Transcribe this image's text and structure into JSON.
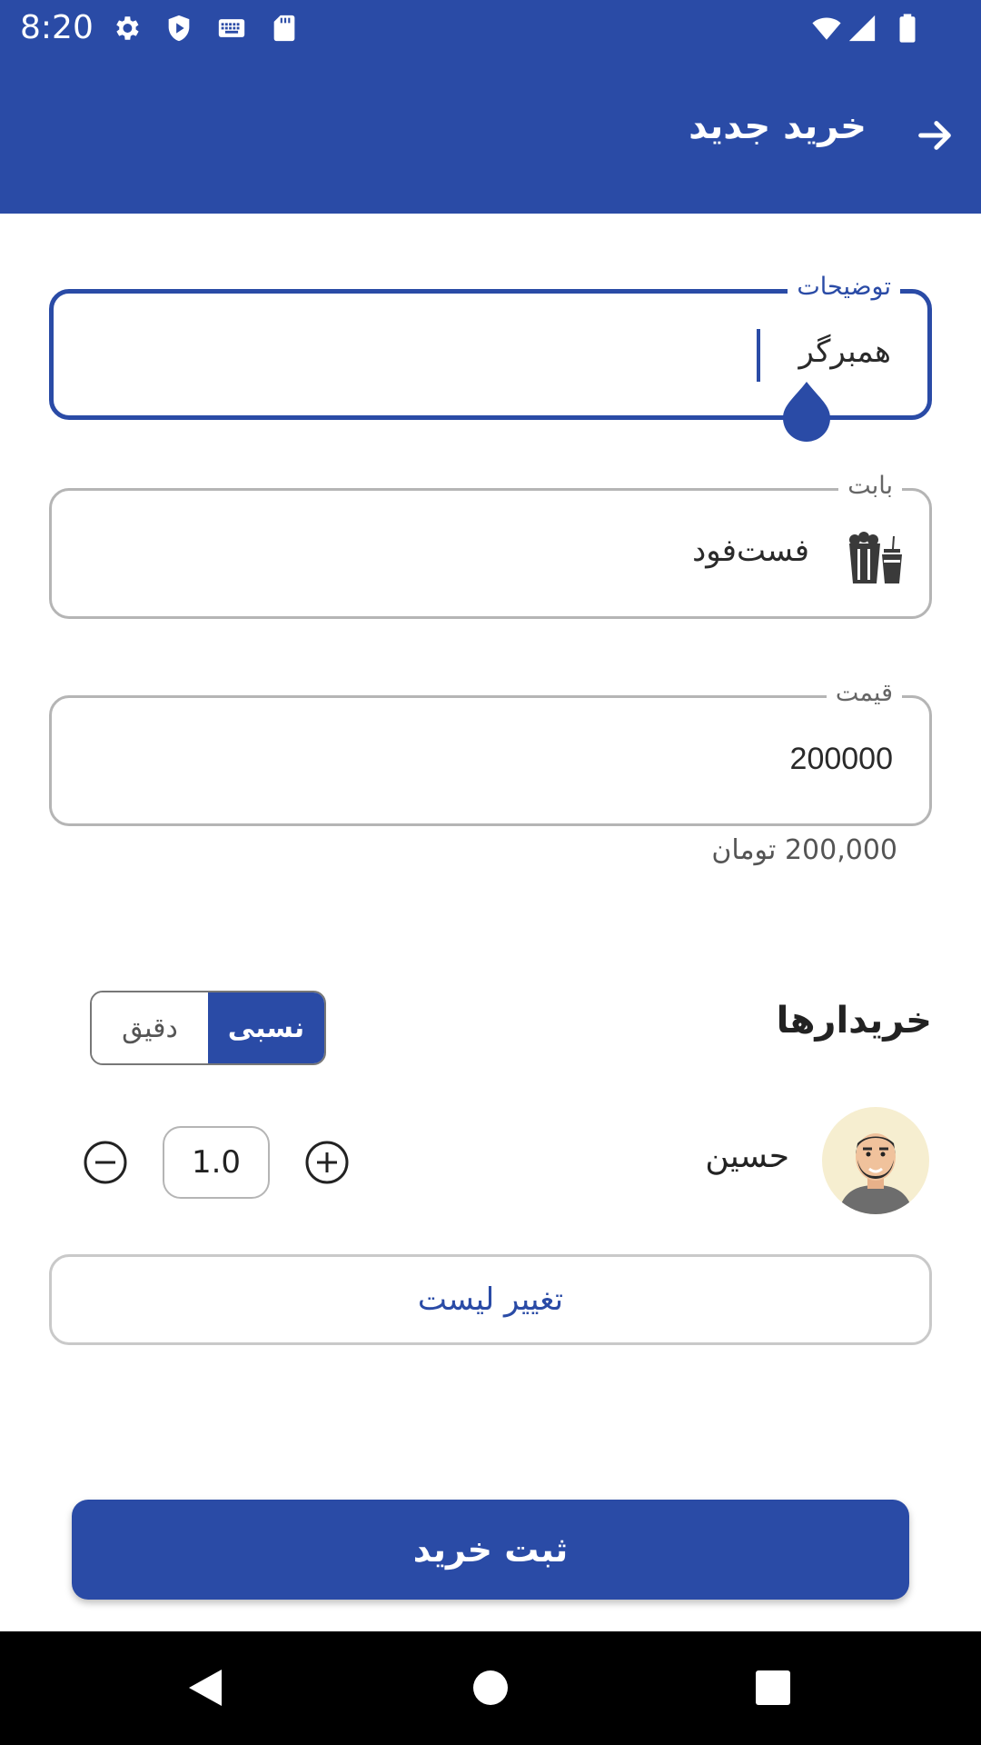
{
  "status_bar": {
    "time": "8:20",
    "icons": [
      "gear-icon",
      "shield-play-icon",
      "keyboard-icon",
      "sd-card-icon",
      "wifi-icon",
      "signal-icon",
      "battery-icon"
    ]
  },
  "toolbar": {
    "title": "خرید جدید",
    "back_icon": "arrow-right-icon"
  },
  "fields": {
    "description": {
      "label": "توضیحات",
      "value": "همبرگر"
    },
    "category": {
      "label": "بابت",
      "value": "فست‌فود",
      "icon": "fastfood-icon"
    },
    "price": {
      "label": "قیمت",
      "value": "200000",
      "helper": "200,000 تومان"
    }
  },
  "buyers": {
    "title": "خریدارها",
    "mode_exact": "دقیق",
    "mode_relative": "نسبی",
    "selected_mode": "نسبی",
    "items": [
      {
        "name": "حسین",
        "quantity": "1.0"
      }
    ],
    "change_list_label": "تغییر لیست"
  },
  "submit_label": "ثبت خرید",
  "colors": {
    "primary": "#2a4ba6",
    "border": "#b5b5b5",
    "text": "#222222"
  }
}
